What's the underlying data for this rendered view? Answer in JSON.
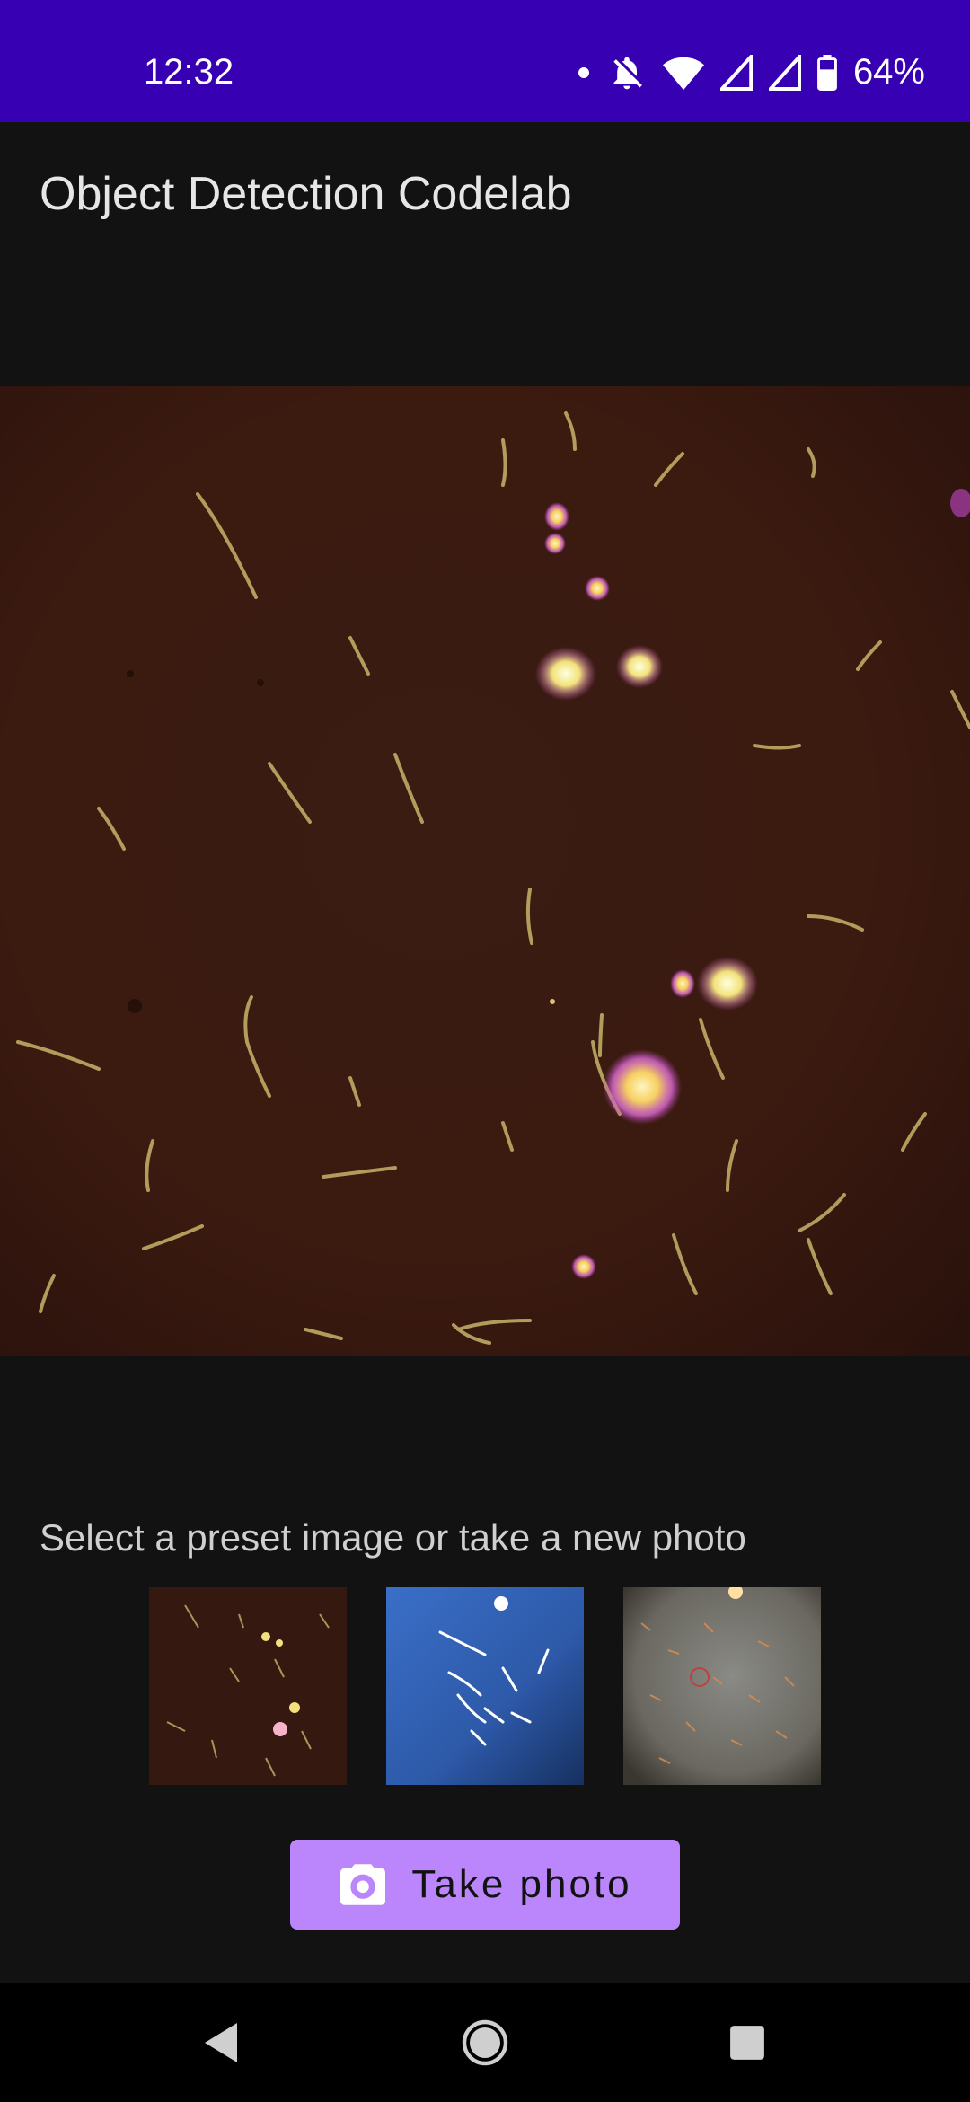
{
  "status_bar": {
    "time": "12:32",
    "battery_percent": "64%",
    "icons": [
      "notification-dot-icon",
      "bell-off-icon",
      "wifi-icon",
      "signal-icon",
      "signal-icon",
      "battery-icon"
    ],
    "background_color": "#3700b3"
  },
  "app_bar": {
    "title": "Object Detection Codelab"
  },
  "main": {
    "image_icon": "microscope-sample-image"
  },
  "preset": {
    "prompt": "Select a preset image or take a new photo",
    "thumbnails": [
      {
        "icon": "preset-image-1"
      },
      {
        "icon": "preset-image-2"
      },
      {
        "icon": "preset-image-3"
      }
    ]
  },
  "actions": {
    "take_photo_label": "Take photo",
    "take_photo_icon": "camera-icon",
    "accent_color": "#bb86fc"
  },
  "nav_bar": {
    "icons": [
      "back-icon",
      "home-icon",
      "recents-icon"
    ]
  }
}
